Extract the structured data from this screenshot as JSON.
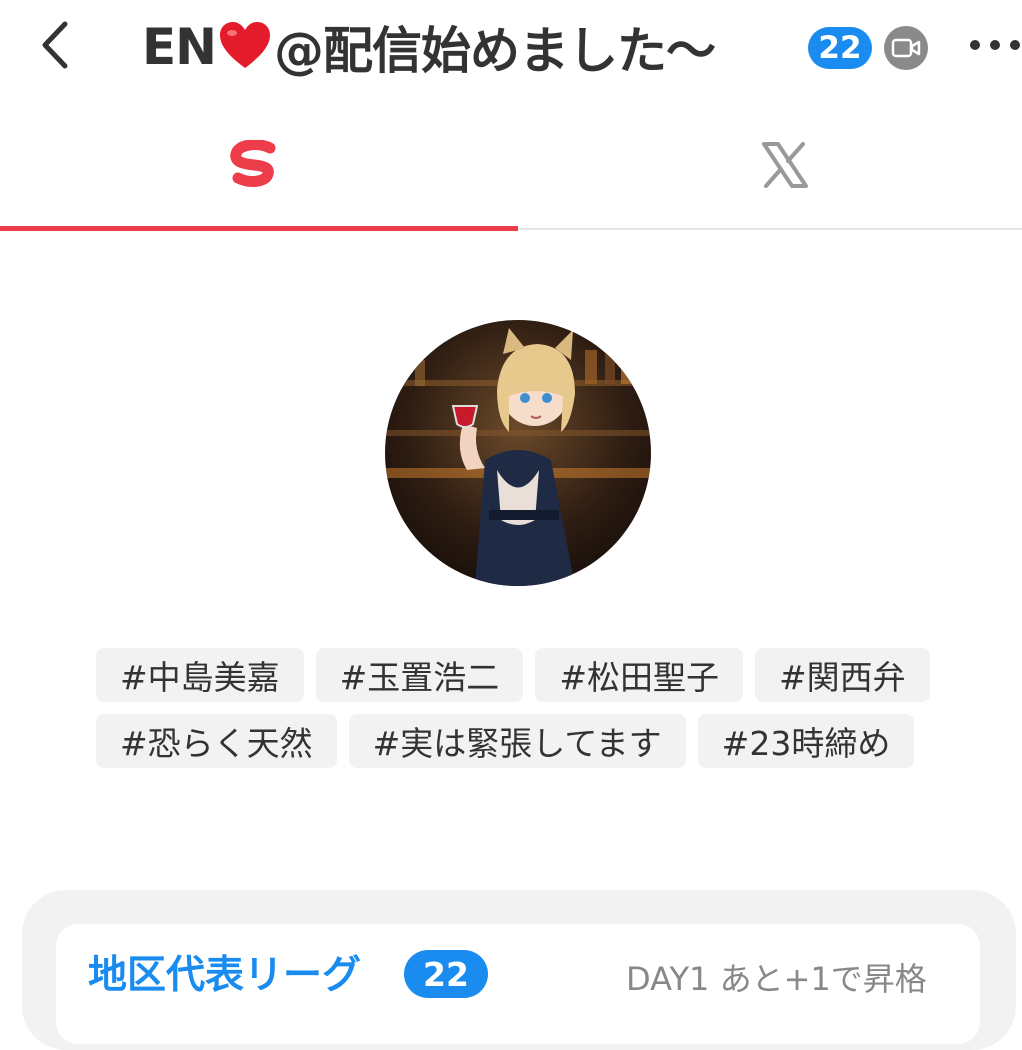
{
  "header": {
    "back_icon": "chevron-left-icon",
    "title_prefix": "EN",
    "title_icon": "red-heart-icon",
    "title_suffix": "@配信始めました〜",
    "level_badge": "22",
    "camera_icon": "video-camera-icon",
    "more_icon": "more-dots-icon"
  },
  "tabs": [
    {
      "icon": "s-logo-icon",
      "active": true
    },
    {
      "icon": "x-logo-icon",
      "active": false
    }
  ],
  "profile": {
    "avatar": "avatar-image"
  },
  "tags": {
    "row1": [
      "#中島美嘉",
      "#玉置浩二",
      "#松田聖子",
      "#関西弁"
    ],
    "row2": [
      "#恐らく天然",
      "#実は緊張してます",
      "#23時締め"
    ]
  },
  "league": {
    "title": "地区代表リーグ",
    "badge": "22",
    "status": "DAY1 あと+1で昇格"
  },
  "colors": {
    "accent_red": "#ee3d4a",
    "accent_blue": "#1a8cf0",
    "tag_bg": "#f2f2f2"
  }
}
